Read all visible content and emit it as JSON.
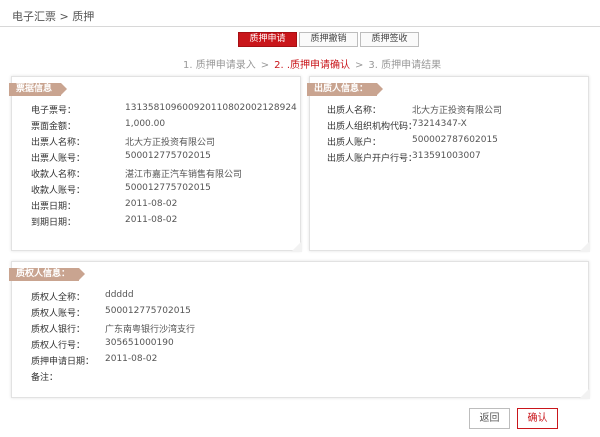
{
  "breadcrumb": "电子汇票 > 质押",
  "tabs": [
    {
      "label": "质押申请",
      "active": true
    },
    {
      "label": "质押撤销",
      "active": false
    },
    {
      "label": "质押签收",
      "active": false
    }
  ],
  "steps": [
    {
      "label": "1. 质押申请录入",
      "current": false
    },
    {
      "label": "2. .质押申请确认",
      "current": true
    },
    {
      "label": "3. 质押申请结果",
      "current": false
    }
  ],
  "step_separator": ">",
  "bill_info": {
    "title": "票据信息",
    "rows": [
      {
        "label": "电子票号：",
        "value": "131358109600920110802002128924"
      },
      {
        "label": "票面金额：",
        "value": "1,000.00"
      },
      {
        "label": "出票人名称：",
        "value": "北大方正投资有限公司"
      },
      {
        "label": "出票人账号：",
        "value": "500012775702015"
      },
      {
        "label": "收款人名称：",
        "value": "湛江市嘉正汽车销售有限公司"
      },
      {
        "label": "收款人账号：",
        "value": "500012775702015"
      },
      {
        "label": "出票日期：",
        "value": "2011-08-02"
      },
      {
        "label": "到期日期：",
        "value": "2011-08-02"
      }
    ]
  },
  "pledgor_info": {
    "title": "出质人信息：",
    "rows": [
      {
        "label": "出质人名称：",
        "value": "北大方正投资有限公司"
      },
      {
        "label": "出质人组织机构代码：",
        "value": "73214347-X"
      },
      {
        "label": "出质人账户：",
        "value": "500002787602015"
      },
      {
        "label": "出质人账户开户行号：",
        "value": "313591003007"
      }
    ]
  },
  "pledgee_info": {
    "title": "质权人信息：",
    "rows": [
      {
        "label": "质权人全称：",
        "value": "ddddd"
      },
      {
        "label": "质权人账号：",
        "value": "500012775702015"
      },
      {
        "label": "质权人银行：",
        "value": "广东南粤银行沙湾支行"
      },
      {
        "label": "质权人行号：",
        "value": "305651000190"
      },
      {
        "label": "质押申请日期：",
        "value": "2011-08-02"
      },
      {
        "label": "备注：",
        "value": ""
      }
    ]
  },
  "buttons": {
    "back": "返回",
    "confirm": "确认"
  },
  "colors": {
    "accent": "#c9161b",
    "ribbon": "#c9a490"
  }
}
